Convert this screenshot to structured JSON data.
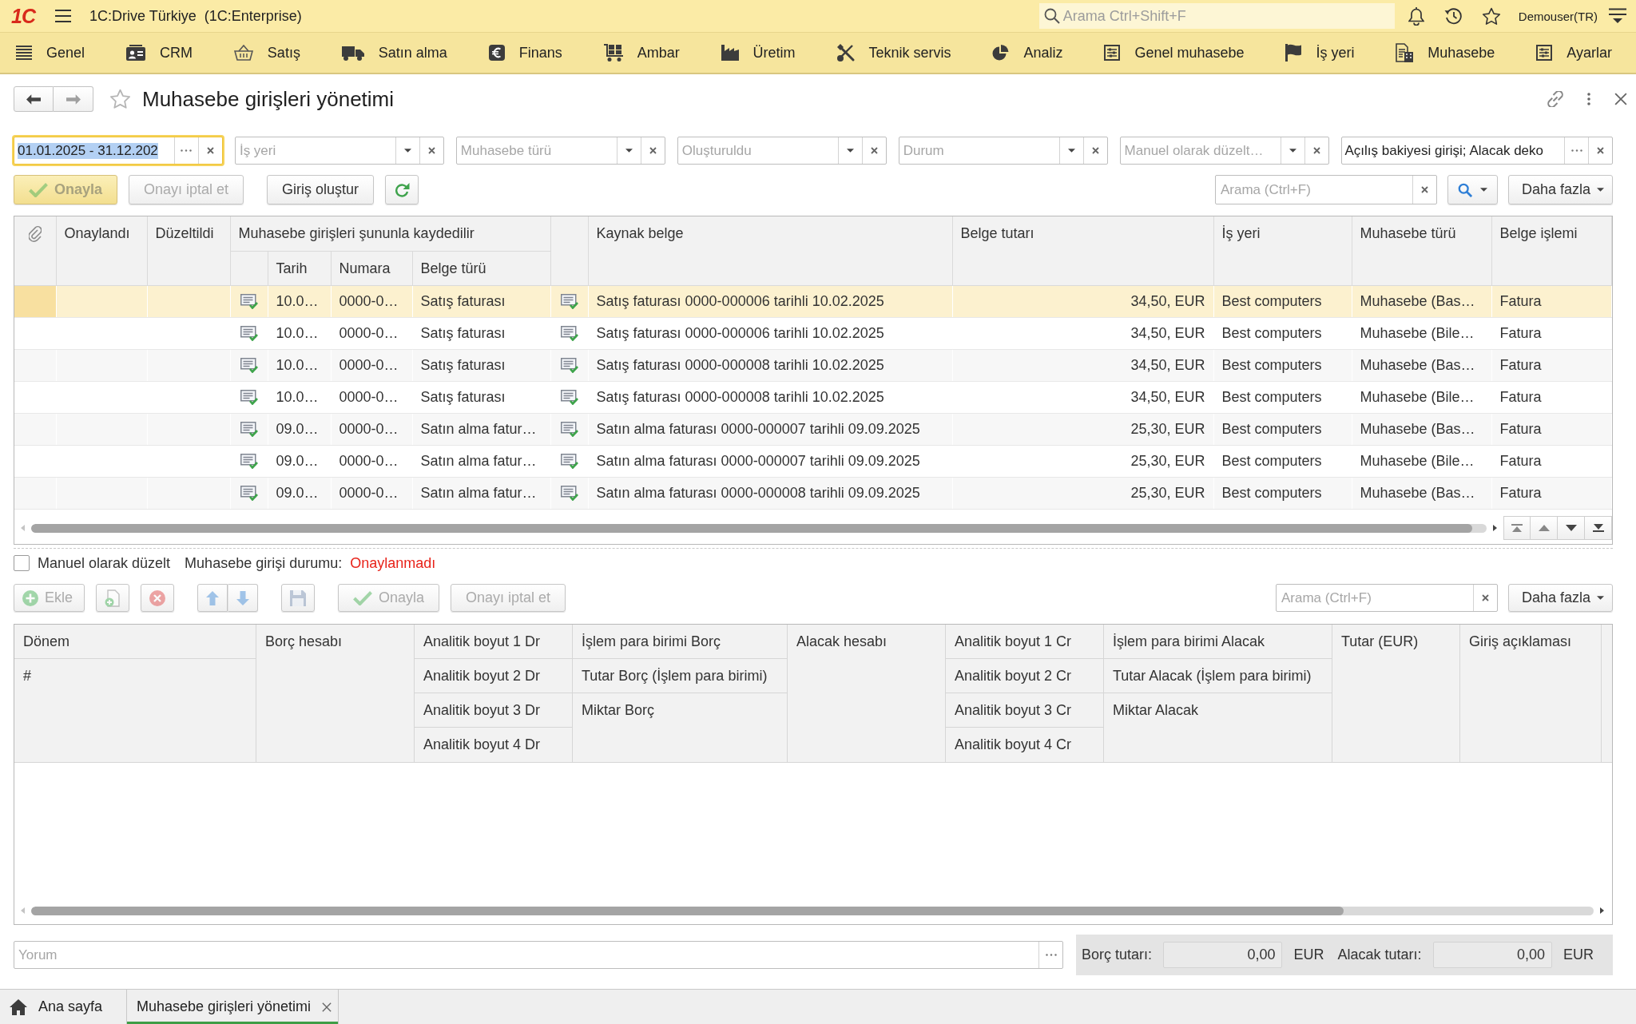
{
  "app_bar": {
    "logo": "1C",
    "title": "1C:Drive Türkiye  (1C:Enterprise)",
    "search": {
      "placeholder": "Arama Ctrl+Shift+F"
    },
    "user": "Demouser(TR)"
  },
  "sections": [
    {
      "label": "Genel"
    },
    {
      "label": "CRM"
    },
    {
      "label": "Satış"
    },
    {
      "label": "Satın alma"
    },
    {
      "label": "Finans"
    },
    {
      "label": "Ambar"
    },
    {
      "label": "Üretim"
    },
    {
      "label": "Teknik servis"
    },
    {
      "label": "Analiz"
    },
    {
      "label": "Genel muhasebe"
    },
    {
      "label": "İş yeri"
    },
    {
      "label": "Muhasebe"
    },
    {
      "label": "Ayarlar"
    }
  ],
  "page": {
    "title": "Muhasebe girişleri yönetimi",
    "favorite": false
  },
  "filters": [
    {
      "kind": "picker",
      "value": "01.01.2025 - 31.12.202",
      "focused": true
    },
    {
      "kind": "dropdown",
      "placeholder": "İş yeri",
      "focused": false
    },
    {
      "kind": "dropdown",
      "placeholder": "Muhasebe türü",
      "focused": false
    },
    {
      "kind": "dropdown",
      "placeholder": "Oluşturuldu",
      "focused": false
    },
    {
      "kind": "dropdown",
      "placeholder": "Durum",
      "focused": false
    },
    {
      "kind": "dropdown",
      "placeholder": "Manuel olarak düzelt…",
      "focused": false
    },
    {
      "kind": "picker",
      "value": "Açılış bakiyesi girişi; Alacak deko",
      "focused": false
    }
  ],
  "toolbar": {
    "buttons": [
      {
        "kind": "approve",
        "label": "Onayla",
        "default": true,
        "disabled": true
      },
      {
        "kind": "text",
        "label": "Onayı iptal et",
        "default": false,
        "disabled": true
      },
      {
        "kind": "text",
        "label": "Giriş oluştur",
        "default": false,
        "disabled": false
      },
      {
        "kind": "refresh",
        "default": false,
        "disabled": false
      }
    ],
    "search": {
      "placeholder": "Arama (Ctrl+F)"
    },
    "more": "Daha fazla"
  },
  "entries_table": {
    "columns": [
      {
        "kind": "attachment"
      },
      {
        "kind": "check",
        "label": "Onaylandı"
      },
      {
        "kind": "check",
        "label": "Düzeltildi"
      },
      {
        "kind": "group",
        "label": "Muhasebe girişleri şununla kaydedilir",
        "colspan": 4,
        "columns": [
          {
            "kind": "icon"
          },
          {
            "kind": "text",
            "label": "Tarih"
          },
          {
            "kind": "text",
            "label": "Numara"
          },
          {
            "kind": "text",
            "label": "Belge türü"
          }
        ]
      },
      {
        "kind": "icon"
      },
      {
        "kind": "text",
        "label": "Kaynak belge"
      },
      {
        "kind": "amount",
        "label": "Belge tutarı"
      },
      {
        "kind": "text",
        "label": "İş yeri"
      },
      {
        "kind": "text",
        "label": "Muhasebe türü"
      },
      {
        "kind": "text",
        "label": "Belge işlemi"
      }
    ],
    "rows": [
      {
        "selected": true,
        "cells": [
          "",
          "",
          "",
          "",
          "10.0…",
          "0000-0…",
          "Satış faturası",
          "",
          "Satış faturası 0000-000006 tarihli 10.02.2025",
          "34,50, EUR",
          "Best computers",
          "Muhasebe (Bas…",
          "Fatura"
        ]
      },
      {
        "selected": false,
        "cells": [
          "",
          "",
          "",
          "",
          "10.0…",
          "0000-0…",
          "Satış faturası",
          "",
          "Satış faturası 0000-000006 tarihli 10.02.2025",
          "34,50, EUR",
          "Best computers",
          "Muhasebe (Bile…",
          "Fatura"
        ]
      },
      {
        "selected": false,
        "cells": [
          "",
          "",
          "",
          "",
          "10.0…",
          "0000-0…",
          "Satış faturası",
          "",
          "Satış faturası 0000-000008 tarihli 10.02.2025",
          "34,50, EUR",
          "Best computers",
          "Muhasebe (Bas…",
          "Fatura"
        ]
      },
      {
        "selected": false,
        "cells": [
          "",
          "",
          "",
          "",
          "10.0…",
          "0000-0…",
          "Satış faturası",
          "",
          "Satış faturası 0000-000008 tarihli 10.02.2025",
          "34,50, EUR",
          "Best computers",
          "Muhasebe (Bile…",
          "Fatura"
        ]
      },
      {
        "selected": false,
        "cells": [
          "",
          "",
          "",
          "",
          "09.0…",
          "0000-0…",
          "Satın alma fatur…",
          "",
          "Satın alma faturası 0000-000007 tarihli 09.09.2025",
          "25,30, EUR",
          "Best computers",
          "Muhasebe (Bas…",
          "Fatura"
        ]
      },
      {
        "selected": false,
        "cells": [
          "",
          "",
          "",
          "",
          "09.0…",
          "0000-0…",
          "Satın alma fatur…",
          "",
          "Satın alma faturası 0000-000007 tarihli 09.09.2025",
          "25,30, EUR",
          "Best computers",
          "Muhasebe (Bile…",
          "Fatura"
        ]
      },
      {
        "selected": false,
        "cells": [
          "",
          "",
          "",
          "",
          "09.0…",
          "0000-0…",
          "Satın alma fatur…",
          "",
          "Satın alma faturası 0000-000008 tarihli 09.09.2025",
          "25,30, EUR",
          "Best computers",
          "Muhasebe (Bas…",
          "Fatura"
        ]
      }
    ]
  },
  "manual_edit": {
    "label": "Manuel olarak düzelt",
    "checked": false
  },
  "status": {
    "label": "Muhasebe girişi durumu:",
    "value": "Onaylanmadı"
  },
  "lines_toolbar": {
    "buttons": [
      {
        "kind": "add",
        "label": "Ekle",
        "disabled": true
      },
      {
        "kind": "copy",
        "disabled": true
      },
      {
        "kind": "delete",
        "disabled": true
      },
      {
        "kind": "up",
        "disabled": true
      },
      {
        "kind": "down",
        "disabled": true
      },
      {
        "kind": "save",
        "disabled": true
      },
      {
        "kind": "approve",
        "label": "Onayla",
        "disabled": true
      },
      {
        "kind": "text",
        "label": "Onayı iptal et",
        "disabled": true
      }
    ],
    "search": {
      "placeholder": "Arama (Ctrl+F)"
    },
    "more": "Daha fazla"
  },
  "lines_table": {
    "columns": [
      {
        "headers": [
          "Dönem",
          "#"
        ]
      },
      {
        "headers": [
          "Borç hesabı"
        ]
      },
      {
        "headers": [
          "Analitik boyut 1 Dr",
          "Analitik boyut 2 Dr",
          "Analitik boyut 3 Dr",
          "Analitik boyut 4 Dr"
        ]
      },
      {
        "headers": [
          "İşlem para birimi Borç",
          "Tutar Borç (İşlem para birimi)",
          "Miktar Borç"
        ]
      },
      {
        "headers": [
          "Alacak hesabı"
        ]
      },
      {
        "headers": [
          "Analitik boyut 1 Cr",
          "Analitik boyut 2 Cr",
          "Analitik boyut 3 Cr",
          "Analitik boyut 4 Cr"
        ]
      },
      {
        "headers": [
          "İşlem para birimi Alacak",
          "Tutar Alacak (İşlem para birimi)",
          "Miktar Alacak"
        ]
      },
      {
        "headers": [
          "Tutar (EUR)"
        ]
      },
      {
        "headers": [
          "Giriş açıklaması"
        ]
      }
    ]
  },
  "comment": {
    "placeholder": "Yorum"
  },
  "totals": [
    {
      "label": "Borç tutarı:",
      "value": "0,00",
      "currency": "EUR"
    },
    {
      "label": "Alacak tutarı:",
      "value": "0,00",
      "currency": "EUR"
    }
  ],
  "open_tabs": [
    {
      "kind": "home",
      "label": "Ana sayfa",
      "selected": false
    },
    {
      "kind": "page",
      "label": "Muhasebe girişleri yönetimi",
      "selected": true
    }
  ]
}
